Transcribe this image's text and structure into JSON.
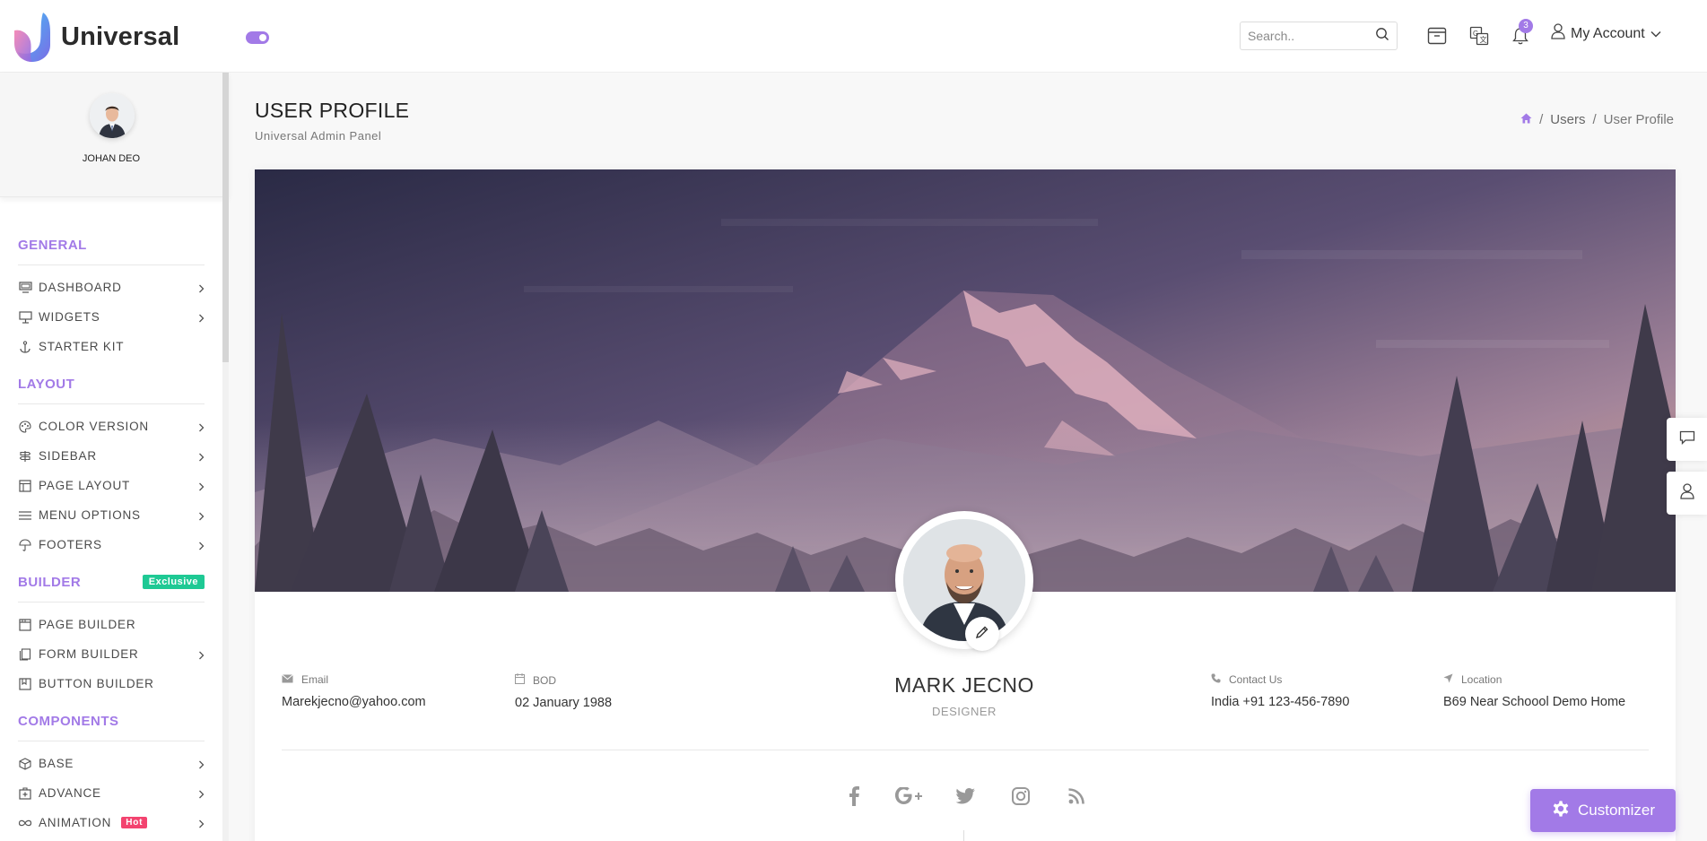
{
  "brand": {
    "name": "Universal"
  },
  "header": {
    "search_placeholder": "Search..",
    "notification_count": "3",
    "account_label": "My Account"
  },
  "sidebar": {
    "user_name": "JOHAN DEO",
    "sections": [
      {
        "title": "GENERAL",
        "items": [
          {
            "label": "DASHBOARD",
            "icon": "monitor-icon",
            "chevron": true
          },
          {
            "label": "WIDGETS",
            "icon": "widget-icon",
            "chevron": true
          },
          {
            "label": "STARTER KIT",
            "icon": "anchor-icon",
            "chevron": false
          }
        ]
      },
      {
        "title": "LAYOUT",
        "items": [
          {
            "label": "COLOR VERSION",
            "icon": "palette-icon",
            "chevron": true
          },
          {
            "label": "SIDEBAR",
            "icon": "signpost-icon",
            "chevron": true
          },
          {
            "label": "PAGE LAYOUT",
            "icon": "layout-icon",
            "chevron": true
          },
          {
            "label": "MENU OPTIONS",
            "icon": "menu-icon",
            "chevron": true
          },
          {
            "label": "FOOTERS",
            "icon": "umbrella-icon",
            "chevron": true
          }
        ]
      },
      {
        "title": "BUILDER",
        "badge": "Exclusive",
        "items": [
          {
            "label": "PAGE BUILDER",
            "icon": "browser-icon",
            "chevron": false
          },
          {
            "label": "FORM BUILDER",
            "icon": "files-icon",
            "chevron": true
          },
          {
            "label": "BUTTON BUILDER",
            "icon": "bookmark-icon",
            "chevron": false
          }
        ]
      },
      {
        "title": "COMPONENTS",
        "items": [
          {
            "label": "BASE",
            "icon": "box-icon",
            "chevron": true
          },
          {
            "label": "ADVANCE",
            "icon": "medkit-icon",
            "chevron": true
          },
          {
            "label": "ANIMATION",
            "icon": "infinity-icon",
            "chevron": true,
            "badge": "Hot"
          }
        ]
      }
    ]
  },
  "page": {
    "title": "USER PROFILE",
    "subtitle": "Universal Admin Panel",
    "breadcrumb": [
      "Users",
      "User Profile"
    ]
  },
  "profile": {
    "name": "MARK JECNO",
    "role": "DESIGNER",
    "email_label": "Email",
    "email": "Marekjecno@yahoo.com",
    "bod_label": "BOD",
    "bod": "02 January 1988",
    "contact_label": "Contact Us",
    "contact": "India +91 123-456-7890",
    "location_label": "Location",
    "location": "B69 Near Schoool Demo Home"
  },
  "social_icons": [
    "facebook-icon",
    "google-plus-icon",
    "twitter-icon",
    "instagram-icon",
    "rss-icon"
  ],
  "customizer_label": "Customizer",
  "colors": {
    "accent": "#a27ae7",
    "exclusive": "#1ec994",
    "hot": "#f3436f"
  }
}
